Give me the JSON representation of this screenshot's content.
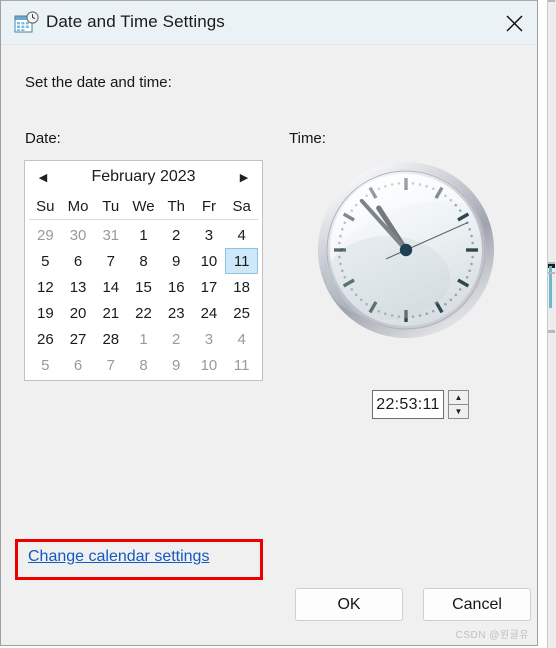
{
  "window": {
    "title": "Date and Time Settings",
    "icon": "calendar-clock-icon",
    "close_label": "✕"
  },
  "body": {
    "instruction": "Set the date and time:",
    "date_label": "Date:",
    "time_label": "Time:"
  },
  "calendar": {
    "month_title": "February 2023",
    "prev_label": "◀",
    "next_label": "▶",
    "weekdays": [
      "Su",
      "Mo",
      "Tu",
      "We",
      "Th",
      "Fr",
      "Sa"
    ],
    "selected_day": 11,
    "weeks": [
      [
        {
          "d": "29",
          "muted": true
        },
        {
          "d": "30",
          "muted": true
        },
        {
          "d": "31",
          "muted": true
        },
        {
          "d": "1",
          "muted": false
        },
        {
          "d": "2",
          "muted": false
        },
        {
          "d": "3",
          "muted": false
        },
        {
          "d": "4",
          "muted": false
        }
      ],
      [
        {
          "d": "5",
          "muted": false
        },
        {
          "d": "6",
          "muted": false
        },
        {
          "d": "7",
          "muted": false
        },
        {
          "d": "8",
          "muted": false
        },
        {
          "d": "9",
          "muted": false
        },
        {
          "d": "10",
          "muted": false
        },
        {
          "d": "11",
          "muted": false,
          "selected": true
        }
      ],
      [
        {
          "d": "12",
          "muted": false
        },
        {
          "d": "13",
          "muted": false
        },
        {
          "d": "14",
          "muted": false
        },
        {
          "d": "15",
          "muted": false
        },
        {
          "d": "16",
          "muted": false
        },
        {
          "d": "17",
          "muted": false
        },
        {
          "d": "18",
          "muted": false
        }
      ],
      [
        {
          "d": "19",
          "muted": false
        },
        {
          "d": "20",
          "muted": false
        },
        {
          "d": "21",
          "muted": false
        },
        {
          "d": "22",
          "muted": false
        },
        {
          "d": "23",
          "muted": false
        },
        {
          "d": "24",
          "muted": false
        },
        {
          "d": "25",
          "muted": false
        }
      ],
      [
        {
          "d": "26",
          "muted": false
        },
        {
          "d": "27",
          "muted": false
        },
        {
          "d": "28",
          "muted": false
        },
        {
          "d": "1",
          "muted": true
        },
        {
          "d": "2",
          "muted": true
        },
        {
          "d": "3",
          "muted": true
        },
        {
          "d": "4",
          "muted": true
        }
      ],
      [
        {
          "d": "5",
          "muted": true
        },
        {
          "d": "6",
          "muted": true
        },
        {
          "d": "7",
          "muted": true
        },
        {
          "d": "8",
          "muted": true
        },
        {
          "d": "9",
          "muted": true
        },
        {
          "d": "10",
          "muted": true
        },
        {
          "d": "11",
          "muted": true
        }
      ]
    ]
  },
  "clock": {
    "name": "analog-clock",
    "hour": 22,
    "minute": 53,
    "second": 11,
    "hour_hand_angle": 327,
    "minute_hand_angle": 318,
    "second_hand_angle": 66
  },
  "time_input": {
    "value": "22:53:11",
    "spinner_up": "▲",
    "spinner_down": "▼"
  },
  "link": {
    "calendar_settings": "Change calendar settings"
  },
  "buttons": {
    "ok": "OK",
    "cancel": "Cancel"
  },
  "annotation": {
    "color": "#ef0000"
  },
  "watermark": {
    "text": "CSDN @원글유"
  },
  "colors": {
    "dialog_bg": "#f0f0f0",
    "titlebar_bg": "#eaf2f5",
    "link": "#1459c0",
    "selected_day_bg": "#cde8f8",
    "muted_text": "#9a9a9a"
  }
}
